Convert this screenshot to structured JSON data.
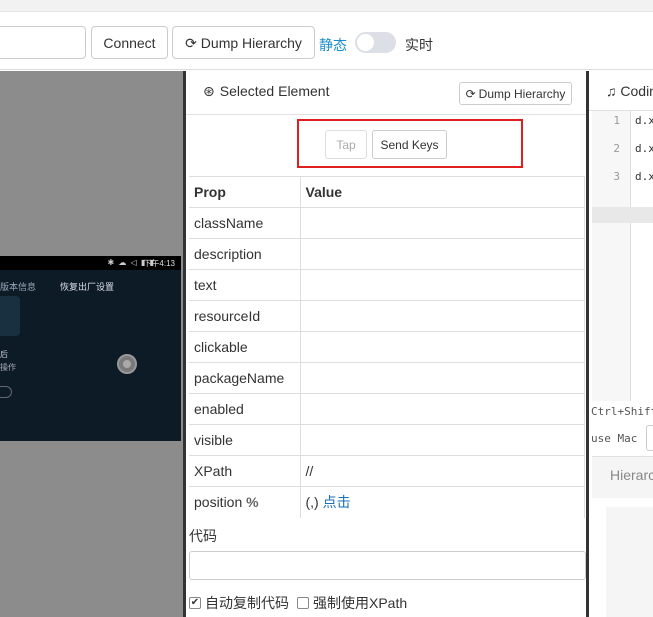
{
  "toolbar": {
    "connect_label": "Connect",
    "dump_label": "Dump Hierarchy",
    "mode_static": "静态",
    "mode_live": "实时"
  },
  "device": {
    "status_time": "下午4:13",
    "menu_item_1": "版本信息",
    "menu_item_2": "恢复出厂设置",
    "line_1": "后",
    "line_2": "操作"
  },
  "inspector": {
    "title": "Selected Element",
    "dump_label": "Dump Hierarchy",
    "tap_label": "Tap",
    "sendkeys_label": "Send Keys",
    "table": {
      "header_prop": "Prop",
      "header_value": "Value",
      "rows": [
        {
          "prop": "className",
          "value": ""
        },
        {
          "prop": "description",
          "value": ""
        },
        {
          "prop": "text",
          "value": ""
        },
        {
          "prop": "resourceId",
          "value": ""
        },
        {
          "prop": "clickable",
          "value": ""
        },
        {
          "prop": "packageName",
          "value": ""
        },
        {
          "prop": "enabled",
          "value": ""
        },
        {
          "prop": "visible",
          "value": ""
        },
        {
          "prop": "XPath",
          "value": "//"
        }
      ],
      "position_prop": "position",
      "position_value": "(,)",
      "position_link": "点击"
    },
    "code_label": "代码",
    "auto_copy_label": "自动复制代码",
    "force_xpath_label": "强制使用XPath"
  },
  "coding": {
    "title": "Coding",
    "lines": [
      {
        "no": "1",
        "text": "d.x"
      },
      {
        "no": "2",
        "text": "d.x"
      },
      {
        "no": "3",
        "text": "d.x"
      }
    ],
    "hint_1": "Ctrl+Shift",
    "hint_2": "use Mac",
    "hierarchy_tab": "Hierarchy"
  },
  "colors": {
    "accent": "#1a8ccc",
    "link": "#1a6fb5",
    "highlight": "#e02020"
  }
}
